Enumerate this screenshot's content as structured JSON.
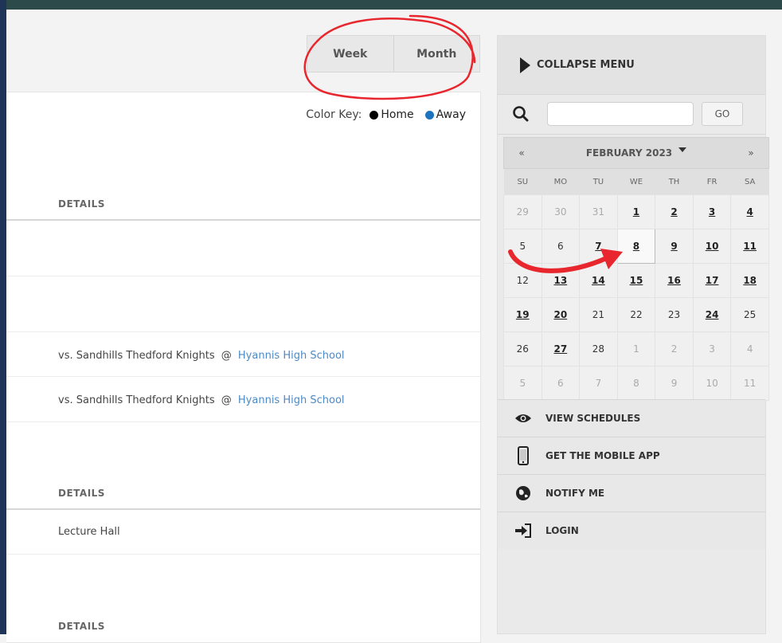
{
  "view_toggle": {
    "week": "Week",
    "month": "Month"
  },
  "color_key": {
    "label": "Color Key:",
    "home": "Home",
    "away": "Away",
    "home_color": "#000000",
    "away_color": "#1e73be"
  },
  "events": {
    "details_header": "DETAILS",
    "opponent": "vs. Sandhills Thedford Knights",
    "at_symbol": "@",
    "location": "Hyannis High School",
    "lecture_hall": "Lecture Hall"
  },
  "sidebar": {
    "collapse_label": "COLLAPSE MENU",
    "search_placeholder": "",
    "go_label": "GO",
    "calendar": {
      "prev": "«",
      "next": "»",
      "month_title": "FEBRUARY 2023",
      "weekdays": [
        "SU",
        "MO",
        "TU",
        "WE",
        "TH",
        "FR",
        "SA"
      ],
      "weeks": [
        [
          "29",
          "30",
          "31",
          "1",
          "2",
          "3",
          "4"
        ],
        [
          "5",
          "6",
          "7",
          "8",
          "9",
          "10",
          "11"
        ],
        [
          "12",
          "13",
          "14",
          "15",
          "16",
          "17",
          "18"
        ],
        [
          "19",
          "20",
          "21",
          "22",
          "23",
          "24",
          "25"
        ],
        [
          "26",
          "27",
          "28",
          "1",
          "2",
          "3",
          "4"
        ],
        [
          "5",
          "6",
          "7",
          "8",
          "9",
          "10",
          "11"
        ]
      ]
    },
    "menu": {
      "view_schedules": "VIEW SCHEDULES",
      "mobile_app": "GET THE MOBILE APP",
      "notify": "NOTIFY ME",
      "login": "LOGIN"
    }
  },
  "annotation_color": "#e8262d"
}
